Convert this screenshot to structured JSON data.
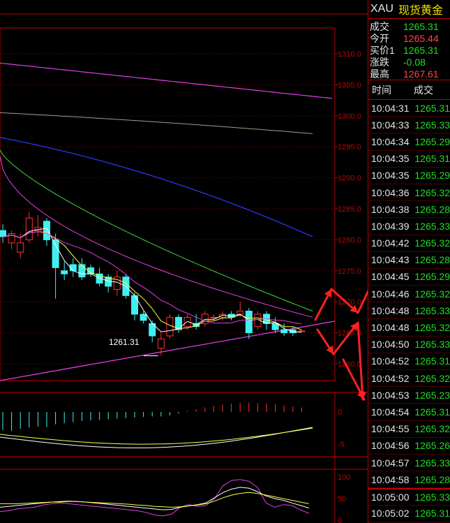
{
  "symbol": "XAU",
  "name": "现货黄金",
  "quotes": [
    {
      "label": "成交",
      "value": "1265.31",
      "color": "#22dd22"
    },
    {
      "label": "今开",
      "value": "1265.44",
      "color": "#ff4444"
    },
    {
      "label": "买价1",
      "value": "1265.31",
      "color": "#22dd22"
    },
    {
      "label": "涨跌",
      "value": "-0.08",
      "color": "#22dd22"
    },
    {
      "label": "最高",
      "value": "1267.61",
      "color": "#ff4444"
    }
  ],
  "ticks_header": {
    "time": "时间",
    "price": "成交"
  },
  "ticks": [
    {
      "time": "10:04:31",
      "price": "1265.31"
    },
    {
      "time": "10:04:33",
      "price": "1265.33"
    },
    {
      "time": "10:04:34",
      "price": "1265.29"
    },
    {
      "time": "10:04:35",
      "price": "1265.31"
    },
    {
      "time": "10:04:35",
      "price": "1265.29"
    },
    {
      "time": "10:04:36",
      "price": "1265.32"
    },
    {
      "time": "10:04:38",
      "price": "1265.28"
    },
    {
      "time": "10:04:39",
      "price": "1265.33"
    },
    {
      "time": "10:04:42",
      "price": "1265.32"
    },
    {
      "time": "10:04:43",
      "price": "1265.28"
    },
    {
      "time": "10:04:45",
      "price": "1265.29"
    },
    {
      "time": "10:04:46",
      "price": "1265.32"
    },
    {
      "time": "10:04:48",
      "price": "1265.33"
    },
    {
      "time": "10:04:48",
      "price": "1265.32"
    },
    {
      "time": "10:04:50",
      "price": "1265.33"
    },
    {
      "time": "10:04:52",
      "price": "1265.31"
    },
    {
      "time": "10:04:52",
      "price": "1265.32"
    },
    {
      "time": "10:04:53",
      "price": "1265.23"
    },
    {
      "time": "10:04:54",
      "price": "1265.31"
    },
    {
      "time": "10:04:55",
      "price": "1265.32"
    },
    {
      "time": "10:04:56",
      "price": "1265.26"
    },
    {
      "time": "10:04:57",
      "price": "1265.33"
    },
    {
      "time": "10:04:58",
      "price": "1265.28"
    },
    {
      "time": "10:05:00",
      "price": "1265.33"
    },
    {
      "time": "10:05:02",
      "price": "1265.31"
    }
  ],
  "price_color": "#22dd22",
  "chart_data": {
    "type": "candlestick",
    "price_axis": [
      "1310.0",
      "1305.0",
      "1300.0",
      "1295.0",
      "1290.0",
      "1285.0",
      "1280.0",
      "1275.0",
      "1270.0",
      "1265.0",
      "1260.0"
    ],
    "low_annotation": "1261.31",
    "macd_axis": [
      "0",
      "-5"
    ],
    "kdj_axis": [
      "100",
      "50",
      "0"
    ],
    "candles": [
      {
        "o": 1281.5,
        "h": 1282.5,
        "l": 1279.5,
        "c": 1280.5
      },
      {
        "o": 1279.5,
        "h": 1281.5,
        "l": 1278.5,
        "c": 1281.0
      },
      {
        "o": 1278.0,
        "h": 1281.0,
        "l": 1277.0,
        "c": 1279.5
      },
      {
        "o": 1280.0,
        "h": 1284.5,
        "l": 1279.5,
        "c": 1283.5
      },
      {
        "o": 1281.5,
        "h": 1284.0,
        "l": 1280.5,
        "c": 1282.0
      },
      {
        "o": 1283.0,
        "h": 1283.5,
        "l": 1279.0,
        "c": 1280.0
      },
      {
        "o": 1280.0,
        "h": 1281.0,
        "l": 1270.5,
        "c": 1275.5
      },
      {
        "o": 1275.0,
        "h": 1276.5,
        "l": 1273.5,
        "c": 1274.5
      },
      {
        "o": 1276.0,
        "h": 1277.0,
        "l": 1274.0,
        "c": 1275.0
      },
      {
        "o": 1276.0,
        "h": 1277.0,
        "l": 1273.5,
        "c": 1274.0
      },
      {
        "o": 1275.5,
        "h": 1276.0,
        "l": 1274.0,
        "c": 1274.5
      },
      {
        "o": 1274.5,
        "h": 1275.5,
        "l": 1272.5,
        "c": 1273.0
      },
      {
        "o": 1274.0,
        "h": 1274.5,
        "l": 1271.5,
        "c": 1272.5
      },
      {
        "o": 1272.0,
        "h": 1275.0,
        "l": 1271.0,
        "c": 1274.0
      },
      {
        "o": 1274.0,
        "h": 1274.5,
        "l": 1270.5,
        "c": 1271.0
      },
      {
        "o": 1271.0,
        "h": 1271.5,
        "l": 1267.0,
        "c": 1268.0
      },
      {
        "o": 1268.0,
        "h": 1268.5,
        "l": 1266.5,
        "c": 1267.0
      },
      {
        "o": 1266.5,
        "h": 1267.0,
        "l": 1263.5,
        "c": 1264.5
      },
      {
        "o": 1262.5,
        "h": 1265.0,
        "l": 1261.3,
        "c": 1264.0
      },
      {
        "o": 1264.5,
        "h": 1268.0,
        "l": 1264.0,
        "c": 1267.5
      },
      {
        "o": 1267.5,
        "h": 1268.0,
        "l": 1265.0,
        "c": 1265.5
      },
      {
        "o": 1266.0,
        "h": 1268.0,
        "l": 1265.5,
        "c": 1267.5
      },
      {
        "o": 1266.5,
        "h": 1268.0,
        "l": 1265.5,
        "c": 1266.0
      },
      {
        "o": 1266.5,
        "h": 1268.5,
        "l": 1266.0,
        "c": 1268.0
      },
      {
        "o": 1267.5,
        "h": 1268.0,
        "l": 1267.0,
        "c": 1267.5
      },
      {
        "o": 1267.5,
        "h": 1268.5,
        "l": 1267.0,
        "c": 1268.0
      },
      {
        "o": 1268.0,
        "h": 1268.5,
        "l": 1267.0,
        "c": 1267.5
      },
      {
        "o": 1268.0,
        "h": 1270.0,
        "l": 1267.5,
        "c": 1268.5
      },
      {
        "o": 1268.5,
        "h": 1269.0,
        "l": 1264.0,
        "c": 1265.0
      },
      {
        "o": 1266.0,
        "h": 1268.5,
        "l": 1265.5,
        "c": 1268.0
      },
      {
        "o": 1268.0,
        "h": 1268.5,
        "l": 1265.5,
        "c": 1266.5
      },
      {
        "o": 1266.5,
        "h": 1267.5,
        "l": 1265.0,
        "c": 1265.5
      },
      {
        "o": 1265.5,
        "h": 1266.5,
        "l": 1264.5,
        "c": 1265.0
      },
      {
        "o": 1265.5,
        "h": 1266.0,
        "l": 1264.5,
        "c": 1265.0
      },
      {
        "o": 1265.3,
        "h": 1265.5,
        "l": 1265.2,
        "c": 1265.3
      }
    ],
    "macd_hist": [
      -3.2,
      -3.4,
      -3.0,
      -2.8,
      -2.6,
      -2.7,
      -2.2,
      -2.0,
      -1.8,
      -1.6,
      -1.5,
      -1.4,
      -1.3,
      -1.2,
      -1.1,
      -1.0,
      -0.9,
      -0.8,
      -0.8,
      -0.6,
      -0.3,
      0.2,
      0.5,
      0.8,
      1.1,
      1.3,
      1.5,
      1.6,
      1.7,
      1.6,
      1.5,
      1.4,
      1.2,
      1.0,
      0.8
    ],
    "kdj_j": [
      20,
      22,
      26,
      28,
      30,
      35,
      38,
      40,
      38,
      36,
      34,
      32,
      30,
      28,
      26,
      24,
      22,
      18,
      12,
      10,
      14,
      30,
      36,
      32,
      34,
      50,
      80,
      92,
      94,
      90,
      76,
      40,
      30,
      36,
      34,
      24,
      16
    ],
    "kdj_k": [
      30,
      32,
      34,
      36,
      38,
      40,
      42,
      43,
      44,
      43,
      42,
      40,
      38,
      36,
      34,
      32,
      30,
      28,
      26,
      24,
      25,
      30,
      33,
      36,
      40,
      52,
      64,
      72,
      76,
      74,
      66,
      56,
      50,
      46,
      40,
      34,
      28
    ],
    "kdj_d": [
      38,
      38,
      38,
      39,
      40,
      41,
      42,
      42,
      43,
      43,
      42,
      41,
      40,
      39,
      38,
      37,
      35,
      34,
      32,
      31,
      30,
      31,
      33,
      35,
      38,
      44,
      52,
      58,
      62,
      64,
      62,
      58,
      54,
      50,
      46,
      42,
      38
    ]
  }
}
